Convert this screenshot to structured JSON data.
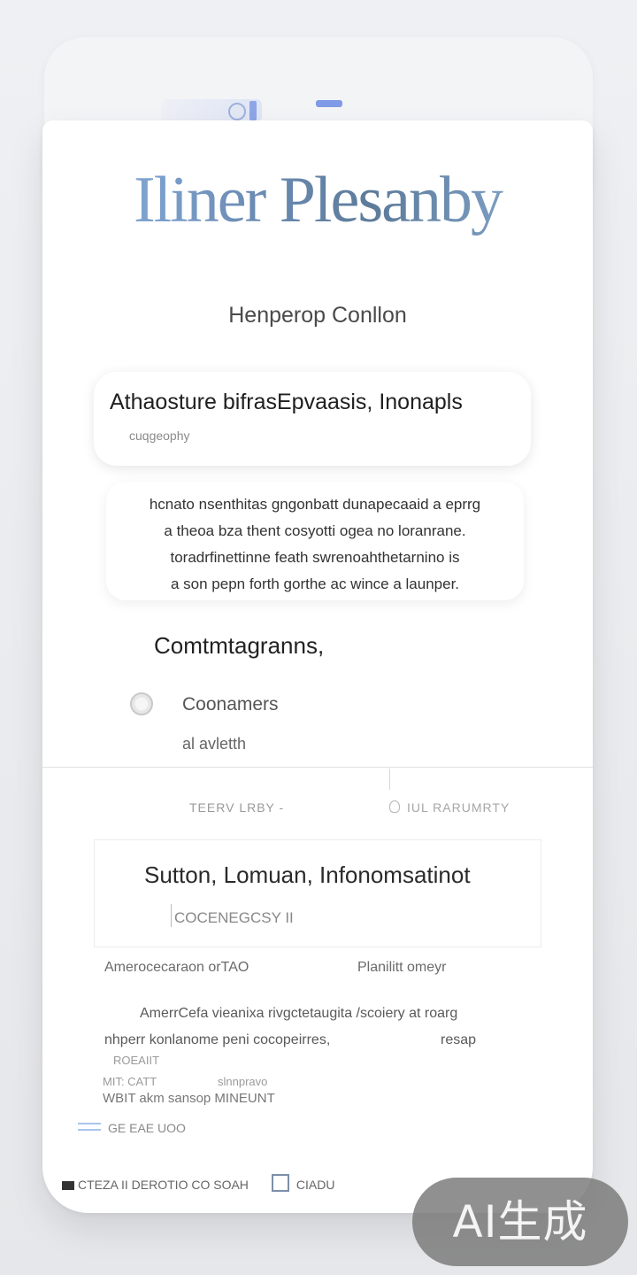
{
  "app": {
    "title": "Iliner Plesanby",
    "subtitle": "Henperop Conllon"
  },
  "hero": {
    "title": "Athaosture bifrasEpvaasis, Inonapls",
    "subtitle": "cuqgeophy"
  },
  "description": {
    "lines": [
      "hcnato nsenthitas gngonbatt dunapecaaid a eprrg",
      "a theoa bza thent cosyotti ogea no loranrane.",
      "toradrfinettinne feath swrenoahthetarnino is",
      "a son pepn forth gorthe ac wince a launper."
    ]
  },
  "comments": {
    "heading": "Comtmtagranns,",
    "option_label": "Coonamers",
    "option_sub": "al avletth"
  },
  "tabs": {
    "left": "TEERV LRBY -",
    "right": "IUL RARUMRTY"
  },
  "info": {
    "title": "Sutton, Lomuan, Infonomsatinot",
    "subtitle": "COCENEGCSY II"
  },
  "meta": {
    "left": "Amerocecaraon orTAO",
    "right": "Planilitt omeyr"
  },
  "body": {
    "line1": "AmerrCefa vieanixa rivgctetaugita /scoiery at roarg",
    "line2": "nhperr konlanome peni cocopeirres,",
    "line2_right": "resap",
    "tiny1": "ROEAIIT",
    "tiny2a": "MIT: CATT",
    "tiny2b": "slnnpravo",
    "line3": "WBIT akm sansop MINEUNT"
  },
  "badge": {
    "label": "GE EAE UOO"
  },
  "footer": {
    "left": "CTEZA II DEROTIO CO SOAH",
    "right": "CIADU"
  },
  "watermark": {
    "text": "AI生成"
  }
}
